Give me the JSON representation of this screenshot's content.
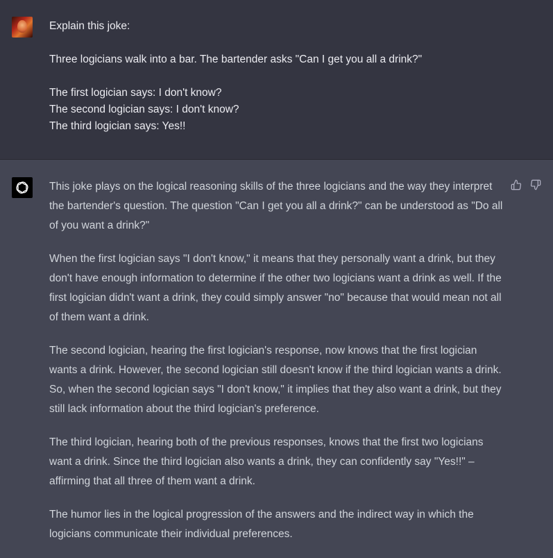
{
  "user": {
    "avatar": "user-avatar-photo",
    "lines": {
      "l1": "Explain this joke:",
      "l2": "Three logicians walk into a bar. The bartender asks \"Can I get you all a drink?\"",
      "l3": "The first logician says: I don't know?",
      "l4": "The second logician says: I don't know?",
      "l5": "The third logician says: Yes!!"
    }
  },
  "assistant": {
    "avatar": "openai-logo-icon",
    "paragraphs": {
      "p1": "This joke plays on the logical reasoning skills of the three logicians and the way they interpret the bartender's question. The question \"Can I get you all a drink?\" can be understood as \"Do all of you want a drink?\"",
      "p2": "When the first logician says \"I don't know,\" it means that they personally want a drink, but they don't have enough information to determine if the other two logicians want a drink as well. If the first logician didn't want a drink, they could simply answer \"no\" because that would mean not all of them want a drink.",
      "p3": "The second logician, hearing the first logician's response, now knows that the first logician wants a drink. However, the second logician still doesn't know if the third logician wants a drink. So, when the second logician says \"I don't know,\" it implies that they also want a drink, but they still lack information about the third logician's preference.",
      "p4": "The third logician, hearing both of the previous responses, knows that the first two logicians want a drink. Since the third logician also wants a drink, they can confidently say \"Yes!!\" – affirming that all three of them want a drink.",
      "p5": "The humor lies in the logical progression of the answers and the indirect way in which the logicians communicate their individual preferences."
    },
    "feedback": {
      "like_icon": "thumbs-up-icon",
      "dislike_icon": "thumbs-down-icon"
    }
  },
  "colors": {
    "user_bg": "#343541",
    "assistant_bg": "#444654",
    "text": "#ececf1",
    "muted_icon": "#acacbe"
  }
}
